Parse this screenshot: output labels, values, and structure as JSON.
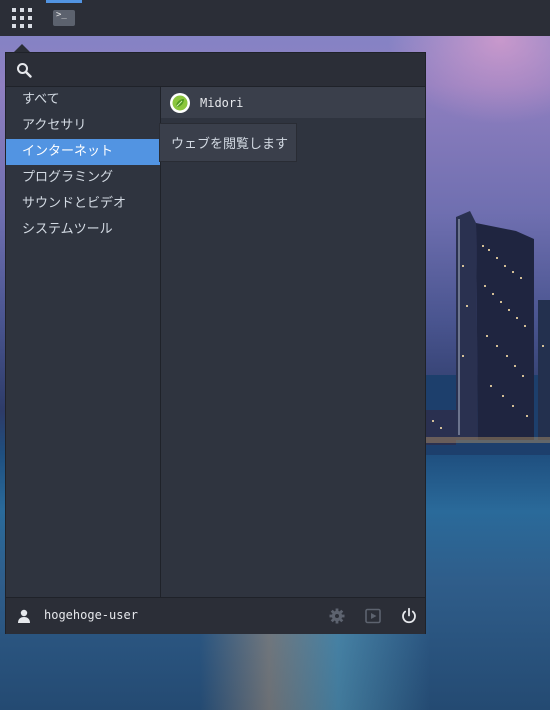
{
  "panel": {
    "launcher_icon": "app-grid-icon",
    "task_icon": "terminal-icon",
    "task_glyph": ">_"
  },
  "launcher": {
    "search": {
      "value": "",
      "placeholder": ""
    },
    "categories": [
      {
        "label": "すべて",
        "selected": false
      },
      {
        "label": "アクセサリ",
        "selected": false
      },
      {
        "label": "インターネット",
        "selected": true
      },
      {
        "label": "プログラミング",
        "selected": false
      },
      {
        "label": "サウンドとビデオ",
        "selected": false
      },
      {
        "label": "システムツール",
        "selected": false
      }
    ],
    "apps": [
      {
        "label": "Midori",
        "icon": "midori-leaf-icon"
      }
    ],
    "tooltip": "ウェブを閲覧します",
    "footer": {
      "username": "hogehoge-user",
      "user_icon": "user-icon",
      "settings_icon": "gear-icon",
      "media_icon": "media-play-icon",
      "power_icon": "power-icon"
    }
  },
  "colors": {
    "accent": "#5294e2",
    "panel_bg": "#2b2e37",
    "menu_bg": "#2f343f",
    "text": "#d3dae3"
  }
}
